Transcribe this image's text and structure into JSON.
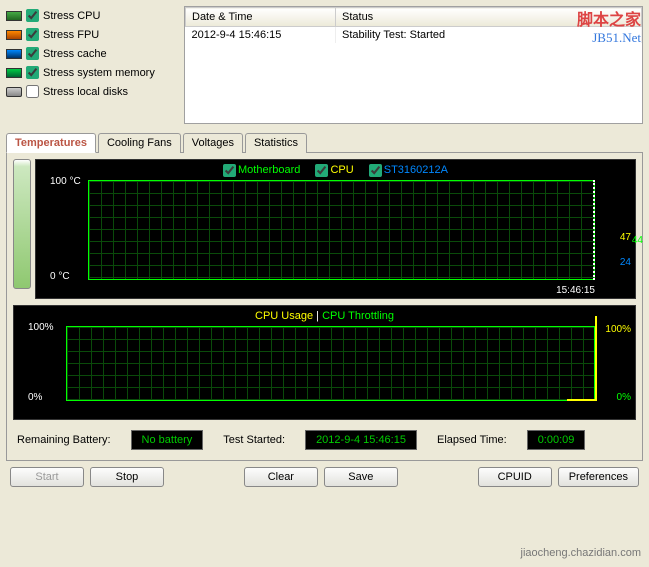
{
  "stress": {
    "cpu": {
      "label": "Stress CPU",
      "checked": true
    },
    "fpu": {
      "label": "Stress FPU",
      "checked": true
    },
    "cache": {
      "label": "Stress cache",
      "checked": true
    },
    "memory": {
      "label": "Stress system memory",
      "checked": true
    },
    "disks": {
      "label": "Stress local disks",
      "checked": false
    }
  },
  "log": {
    "headers": [
      "Date & Time",
      "Status"
    ],
    "rows": [
      {
        "datetime": "2012-9-4 15:46:15",
        "status": "Stability Test: Started"
      }
    ]
  },
  "tabs": [
    "Temperatures",
    "Cooling Fans",
    "Voltages",
    "Statistics"
  ],
  "activeTab": "Temperatures",
  "chart_data": [
    {
      "type": "line",
      "title": "Temperatures",
      "ylabel": "°C",
      "ylim": [
        0,
        100
      ],
      "x_end_label": "15:46:15",
      "series": [
        {
          "name": "Motherboard",
          "color": "#00ff00",
          "current": 44
        },
        {
          "name": "CPU",
          "color": "#ffff00",
          "current": 47
        },
        {
          "name": "ST3160212A",
          "color": "#0088ff",
          "current": 24
        }
      ],
      "y_axis_top": "100 °C",
      "y_axis_bottom": "0 °C"
    },
    {
      "type": "line",
      "title": "CPU Usage / Throttling",
      "ylabel": "%",
      "ylim": [
        0,
        100
      ],
      "series": [
        {
          "name": "CPU Usage",
          "color": "#ffff00",
          "current": 100
        },
        {
          "name": "CPU Throttling",
          "color": "#00ff00",
          "current": 0
        }
      ],
      "y_axis_top": "100%",
      "y_axis_bottom": "0%",
      "right_top": "100%",
      "right_bottom": "0%"
    }
  ],
  "legend2_sep": "  |  ",
  "status": {
    "battery_label": "Remaining Battery:",
    "battery_value": "No battery",
    "started_label": "Test Started:",
    "started_value": "2012-9-4 15:46:15",
    "elapsed_label": "Elapsed Time:",
    "elapsed_value": "0:00:09"
  },
  "buttons": {
    "start": "Start",
    "stop": "Stop",
    "clear": "Clear",
    "save": "Save",
    "cpuid": "CPUID",
    "prefs": "Preferences"
  },
  "watermark": {
    "line1": "脚本之家",
    "line2": "JB51.Net",
    "bottom": "jiaocheng.chazidian.com"
  }
}
